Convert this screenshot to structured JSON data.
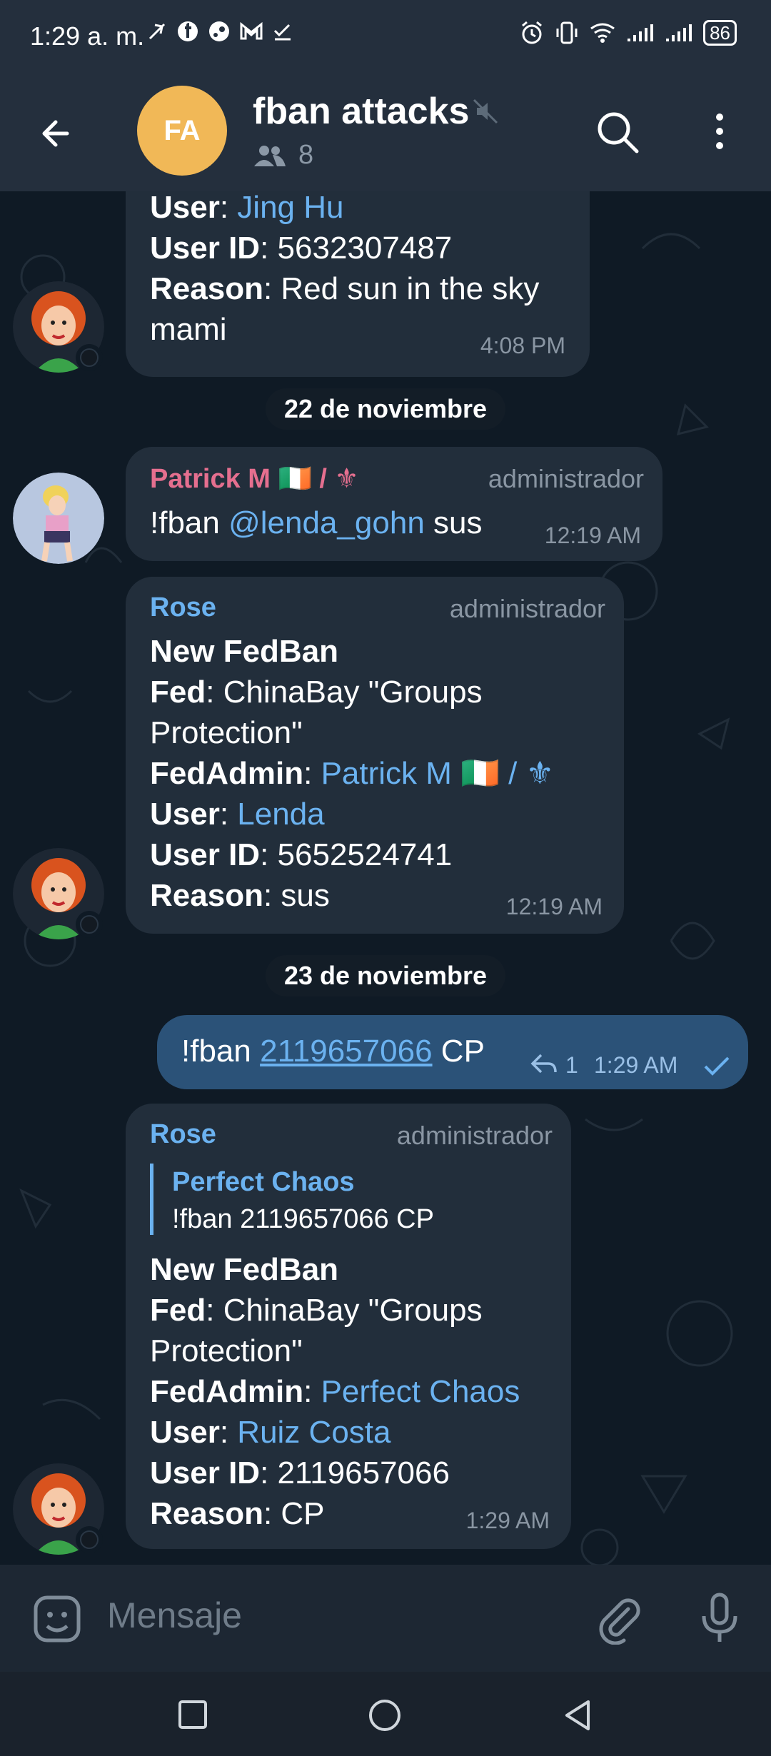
{
  "status_bar": {
    "time": "1:29 a. m.",
    "battery": "86"
  },
  "header": {
    "avatar_initials": "FA",
    "title": "fban attacks",
    "member_count": "8"
  },
  "messages": {
    "m1": {
      "user_label": "User",
      "user_value": "Jing Hu",
      "userid_label": "User ID",
      "userid_value": "5632307487",
      "reason_label": "Reason",
      "reason_value": "Red sun in the sky mami",
      "time": "4:08 PM"
    },
    "date1": "22 de noviembre",
    "m2": {
      "sender": "Patrick M 🇮🇪 / ⚜",
      "role": "administrador",
      "cmd": "!fban",
      "mention": "@lenda_gohn",
      "tail": " sus",
      "time": "12:19 AM"
    },
    "m3": {
      "sender": "Rose",
      "role": "administrador",
      "heading": "New FedBan",
      "fed_label": "Fed",
      "fed_value": "ChinaBay \"Groups Protection\"",
      "fedadmin_label": "FedAdmin",
      "fedadmin_value": "Patrick M 🇮🇪 / ⚜",
      "user_label": "User",
      "user_value": "Lenda",
      "userid_label": "User ID",
      "userid_value": "5652524741",
      "reason_label": "Reason",
      "reason_value": "sus",
      "time": "12:19 AM"
    },
    "date2": "23 de noviembre",
    "m4": {
      "cmd": "!fban",
      "id_link": "2119657066",
      "tail": "CP",
      "reply_count": "1",
      "time": "1:29 AM"
    },
    "m5": {
      "sender": "Rose",
      "role": "administrador",
      "quote_author": "Perfect Chaos",
      "quote_text": "!fban 2119657066 CP",
      "heading": "New FedBan",
      "fed_label": "Fed",
      "fed_value": "ChinaBay \"Groups Protection\"",
      "fedadmin_label": "FedAdmin",
      "fedadmin_value": "Perfect Chaos",
      "user_label": "User",
      "user_value": "Ruiz Costa",
      "userid_label": "User ID",
      "userid_value": "2119657066",
      "reason_label": "Reason",
      "reason_value": "CP",
      "time": "1:29 AM"
    }
  },
  "composer": {
    "placeholder": "Mensaje"
  },
  "colors": {
    "header_bg": "#242f3d",
    "chat_bg": "#0f1a25",
    "bubble_in": "#222e3b",
    "bubble_out": "#2b5278",
    "link": "#6bb2f0",
    "patrick_name": "#e56f8f",
    "rose_name": "#6bb2f0",
    "avatar_fa": "#f1b857"
  },
  "icons": [
    "back-arrow-icon",
    "mute-icon",
    "members-icon",
    "search-icon",
    "more-vert-icon",
    "reply-icon",
    "read-check-icon",
    "sticker-icon",
    "attach-icon",
    "mic-icon",
    "nav-recent-icon",
    "nav-home-icon",
    "nav-back-icon"
  ]
}
